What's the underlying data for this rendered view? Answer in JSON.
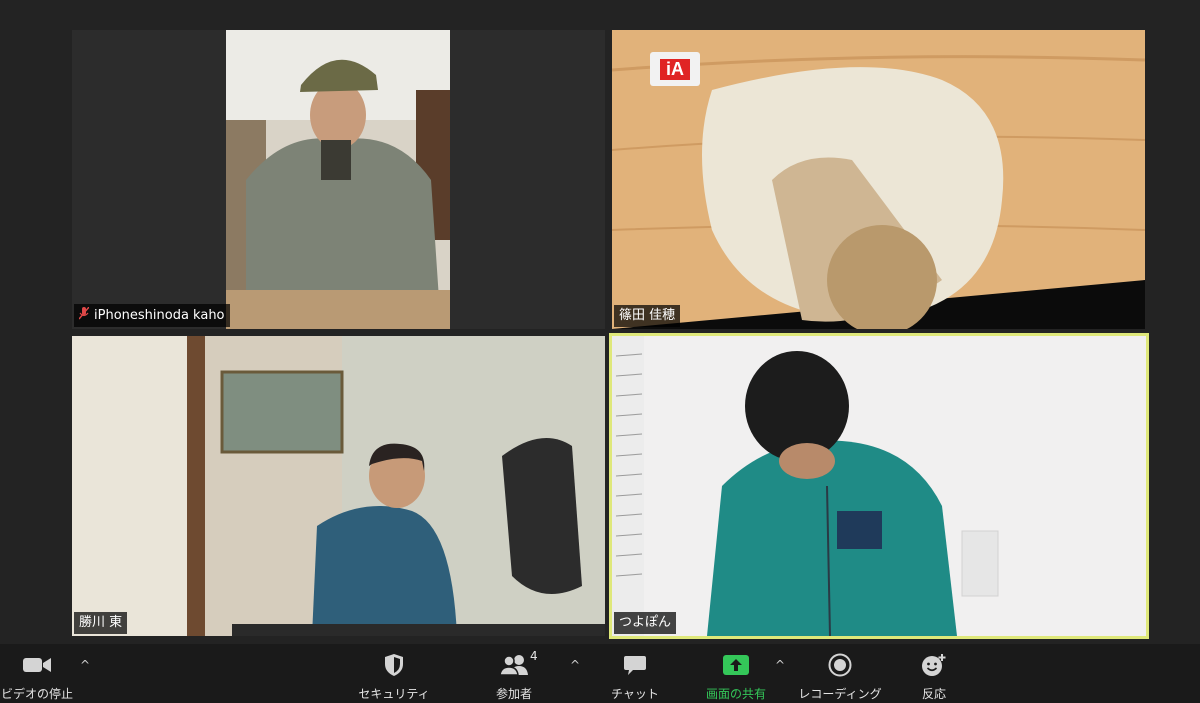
{
  "participants": [
    {
      "name": "iPhoneshinoda kaho",
      "muted": true
    },
    {
      "name": "篠田 佳穂",
      "muted": false
    },
    {
      "name": "勝川 東",
      "muted": false
    },
    {
      "name": "つよぽん",
      "muted": false,
      "active_speaker": true
    }
  ],
  "overlay_badge": "iA",
  "toolbar": {
    "video_label": "ビデオの停止",
    "security_label": "セキュリティ",
    "participants_label": "参加者",
    "participants_count": "4",
    "chat_label": "チャット",
    "share_label": "画面の共有",
    "record_label": "レコーディング",
    "reactions_label": "反応"
  },
  "colors": {
    "active_speaker_border": "#dfe87a",
    "share_green": "#34c759",
    "muted_red": "#e04848"
  }
}
